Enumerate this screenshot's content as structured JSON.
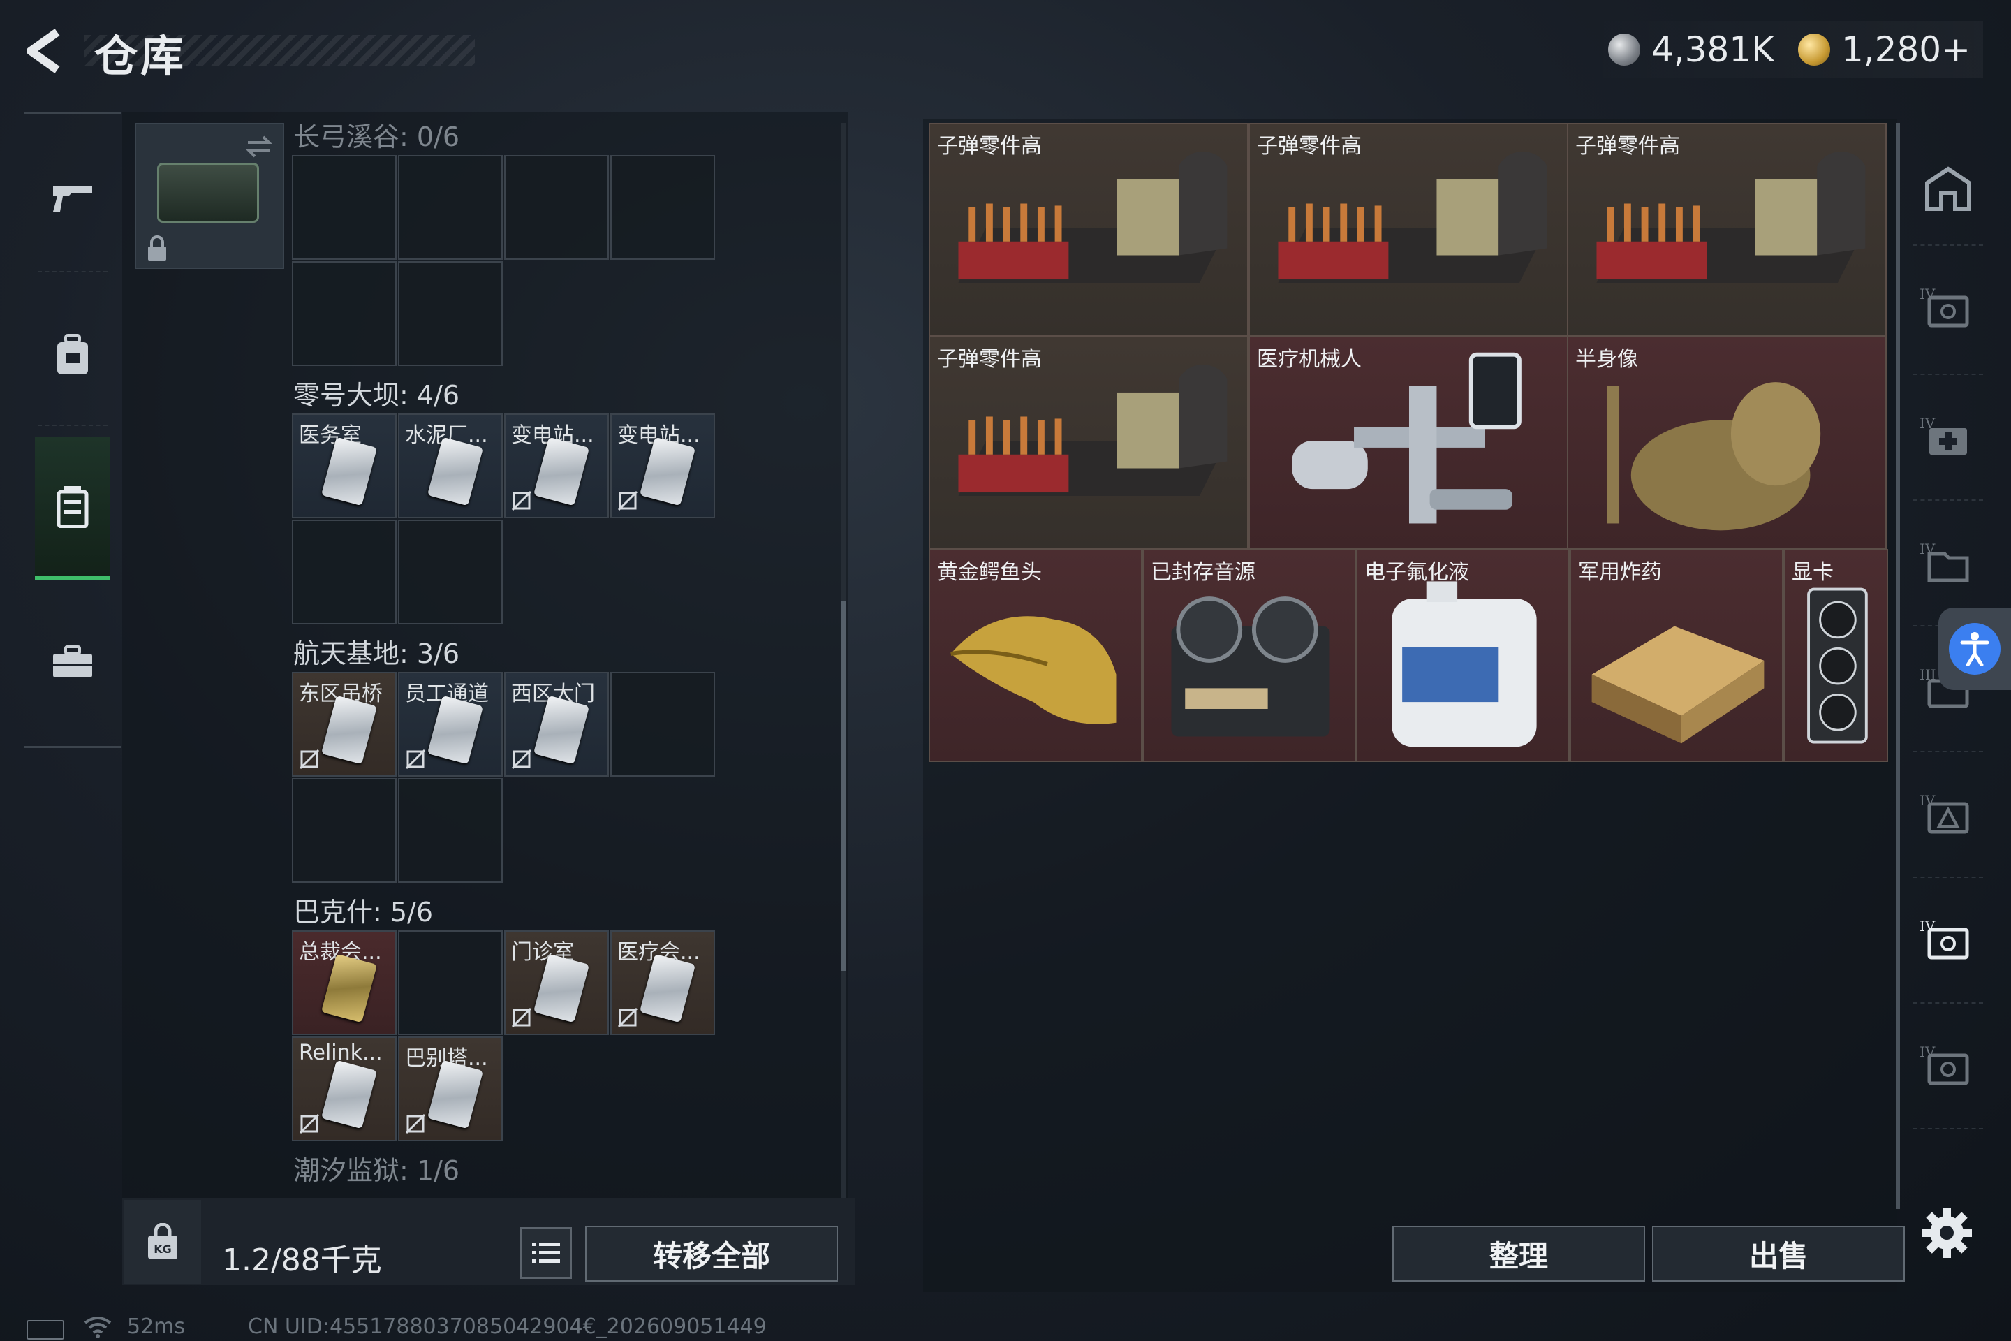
{
  "header": {
    "title": "仓库",
    "back_icon": "chevron-left-icon",
    "currency": [
      {
        "icon": "silver-coin-icon",
        "value": "4,381K"
      },
      {
        "icon": "gold-coin-icon",
        "value": "1,280+"
      }
    ]
  },
  "left_nav": [
    {
      "id": "weapons",
      "icon": "gun-icon"
    },
    {
      "id": "backpack",
      "icon": "backpack-icon"
    },
    {
      "id": "keycard-case",
      "icon": "keycard-case-icon",
      "active": true
    },
    {
      "id": "toolbox",
      "icon": "toolbox-icon"
    }
  ],
  "keycard_sections": [
    {
      "title": "长弓溪谷: 0/6"
    },
    {
      "title": "零号大坝: 4/6",
      "cards": [
        "医务室",
        "水泥厂...",
        "变电站...",
        "变电站..."
      ]
    },
    {
      "title": "航天基地: 3/6",
      "cards": [
        "东区吊桥",
        "员工通道",
        "西区大门"
      ]
    },
    {
      "title": "巴克什: 5/6",
      "cards": [
        "总裁会...",
        "门诊室",
        "医疗会...",
        "Relink...",
        "巴别塔..."
      ]
    },
    {
      "title": "潮汐监狱: 1/6"
    }
  ],
  "bottom_left": {
    "weight": "1.2/88千克",
    "transfer_all": "转移全部"
  },
  "items": [
    {
      "label": "子弹零件高",
      "rarity": "gold"
    },
    {
      "label": "子弹零件高",
      "rarity": "gold"
    },
    {
      "label": "子弹零件高",
      "rarity": "gold"
    },
    {
      "label": "子弹零件高",
      "rarity": "gold"
    },
    {
      "label": "医疗机械人",
      "rarity": "red"
    },
    {
      "label": "半身像",
      "rarity": "red"
    },
    {
      "label": "黄金鳄鱼头",
      "rarity": "red"
    },
    {
      "label": "已封存音源",
      "rarity": "red"
    },
    {
      "label": "电子氟化液",
      "rarity": "red"
    },
    {
      "label": "军用炸药",
      "rarity": "red"
    },
    {
      "label": "显卡",
      "rarity": "red"
    }
  ],
  "bottom_right": {
    "sort": "整理",
    "sell": "出售"
  },
  "right_nav_icons": [
    "home-icon",
    "tier4-safe-icon",
    "tier4-medkit-icon",
    "tier4-folder-icon",
    "tier3-case-icon",
    "tier4-triangle-icon",
    "tier4-safe-active-icon",
    "tier4-safe-icon-2"
  ],
  "status": {
    "ping": "52ms",
    "uid": "CN UID:4551788037085042904€_202609051449"
  },
  "colors": {
    "accent_green": "#3fbf6a",
    "rarity_gold_bg": "#3b332d",
    "rarity_red_bg": "#442729",
    "accessibility_blue": "#3b7ff0"
  }
}
